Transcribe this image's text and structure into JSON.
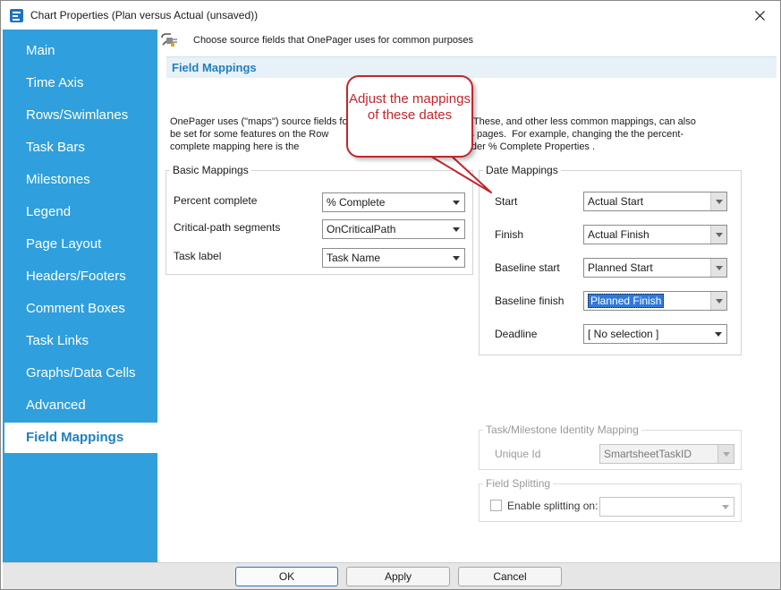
{
  "window": {
    "title": "Chart Properties (Plan versus Actual (unsaved))",
    "accent_color": "#2f9fdd"
  },
  "sidebar": {
    "items": [
      {
        "label": "Main",
        "active": false
      },
      {
        "label": "Time Axis",
        "active": false
      },
      {
        "label": "Rows/Swimlanes",
        "active": false
      },
      {
        "label": "Task Bars",
        "active": false
      },
      {
        "label": "Milestones",
        "active": false
      },
      {
        "label": "Legend",
        "active": false
      },
      {
        "label": "Page Layout",
        "active": false
      },
      {
        "label": "Headers/Footers",
        "active": false
      },
      {
        "label": "Comment Boxes",
        "active": false
      },
      {
        "label": "Task Links",
        "active": false
      },
      {
        "label": "Graphs/Data Cells",
        "active": false
      },
      {
        "label": "Advanced",
        "active": false
      },
      {
        "label": "Field Mappings",
        "active": true
      }
    ]
  },
  "main": {
    "hint": "Choose source fields that OnePager uses for common purposes",
    "section_title": "Field Mappings",
    "description": "OnePager uses (\"maps\") source fields fo                                        ge. These, and other less common mappings, can also be set for some features on the Row                                       ilestones pages.  For example, changing the the percent-complete mapping here is the                                     sk Bars page under % Complete Properties .",
    "basic_mappings": {
      "legend": "Basic Mappings",
      "rows": [
        {
          "label": "Percent complete",
          "value": "% Complete"
        },
        {
          "label": "Critical-path segments",
          "value": "OnCriticalPath"
        },
        {
          "label": "Task label",
          "value": "Task Name"
        }
      ]
    },
    "date_mappings": {
      "legend": "Date Mappings",
      "rows": [
        {
          "label": "Start",
          "value": "Actual Start"
        },
        {
          "label": "Finish",
          "value": "Actual Finish"
        },
        {
          "label": "Baseline start",
          "value": "Planned Start"
        },
        {
          "label": "Baseline finish",
          "value": "Planned Finish"
        },
        {
          "label": "Deadline",
          "value": "[ No selection ]"
        }
      ]
    },
    "identity_mapping": {
      "legend": "Task/Milestone Identity Mapping",
      "label": "Unique Id",
      "value": "SmartsheetTaskID"
    },
    "field_splitting": {
      "legend": "Field Splitting",
      "checkbox_label": "Enable splitting on:",
      "value": ""
    }
  },
  "callout": {
    "text": "Adjust the mappings of these dates",
    "color": "#c0272d"
  },
  "footer": {
    "ok": "OK",
    "apply": "Apply",
    "cancel": "Cancel"
  }
}
